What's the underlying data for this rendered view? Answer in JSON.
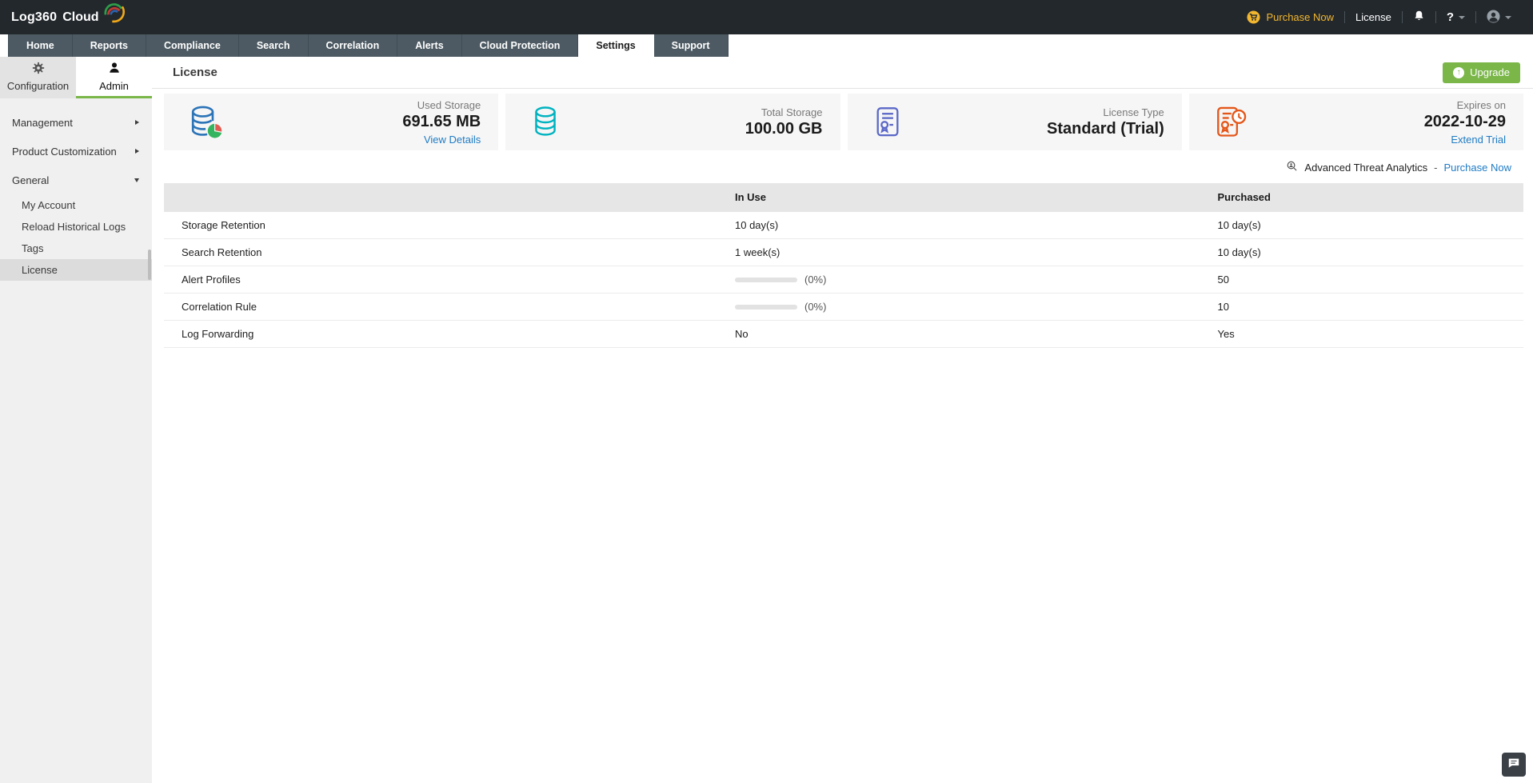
{
  "topbar": {
    "brand_bold": "Log360",
    "brand_light": "Cloud",
    "purchase_now": "Purchase Now",
    "license_label": "License",
    "help_label": "?"
  },
  "nav": {
    "active_tab": "Settings",
    "tabs": [
      {
        "label": "Home"
      },
      {
        "label": "Reports"
      },
      {
        "label": "Compliance"
      },
      {
        "label": "Search"
      },
      {
        "label": "Correlation"
      },
      {
        "label": "Alerts"
      },
      {
        "label": "Cloud Protection"
      },
      {
        "label": "Settings"
      },
      {
        "label": "Support"
      }
    ]
  },
  "sidebar": {
    "tabs": [
      {
        "label": "Configuration",
        "icon": "gear-icon",
        "active": false
      },
      {
        "label": "Admin",
        "icon": "admin-person-icon",
        "active": true
      }
    ],
    "items": [
      {
        "label": "Management",
        "type": "section",
        "arrow": "right"
      },
      {
        "label": "Product Customization",
        "type": "section",
        "arrow": "right"
      },
      {
        "label": "General",
        "type": "section",
        "arrow": "down",
        "expanded": true
      },
      {
        "label": "My Account",
        "type": "child"
      },
      {
        "label": "Reload Historical Logs",
        "type": "child"
      },
      {
        "label": "Tags",
        "type": "child"
      },
      {
        "label": "License",
        "type": "child",
        "active": true
      }
    ]
  },
  "header": {
    "title": "License",
    "upgrade_label": "Upgrade"
  },
  "cards": [
    {
      "label": "Used Storage",
      "value": "691.65 MB",
      "link": "View Details",
      "icon": "database-pie-icon",
      "icon_color": "#2b74b8"
    },
    {
      "label": "Total Storage",
      "value": "100.00 GB",
      "icon": "database-icon",
      "icon_color": "#00b3c0"
    },
    {
      "label": "License Type",
      "value": "Standard (Trial)",
      "icon": "license-certificate-icon",
      "icon_color": "#5b68c8"
    },
    {
      "label": "Expires on",
      "value": "2022-10-29",
      "link": "Extend Trial",
      "icon": "certificate-clock-icon",
      "icon_color": "#e4571a"
    }
  ],
  "ata": {
    "label": "Advanced Threat Analytics",
    "dash": "-",
    "link": "Purchase Now"
  },
  "license_table": {
    "columns": [
      "",
      "In Use",
      "Purchased"
    ],
    "rows": [
      {
        "feature": "Storage Retention",
        "in_use": "10 day(s)",
        "purchased": "10 day(s)"
      },
      {
        "feature": "Search Retention",
        "in_use": "1 week(s)",
        "purchased": "10 day(s)"
      },
      {
        "feature": "Alert Profiles",
        "in_use": "(0%)",
        "in_use_type": "progress",
        "progress_pct": 0,
        "purchased": "50"
      },
      {
        "feature": "Correlation Rule",
        "in_use": "(0%)",
        "in_use_type": "progress",
        "progress_pct": 0,
        "purchased": "10"
      },
      {
        "feature": "Log Forwarding",
        "in_use": "No",
        "purchased": "Yes"
      }
    ]
  },
  "colors": {
    "topbar_bg": "#23282d",
    "nav_bg": "#4d5a63",
    "accent_green": "#7ab648",
    "link_blue": "#1e7bc4",
    "topbar_yellow": "#f2b72e"
  }
}
